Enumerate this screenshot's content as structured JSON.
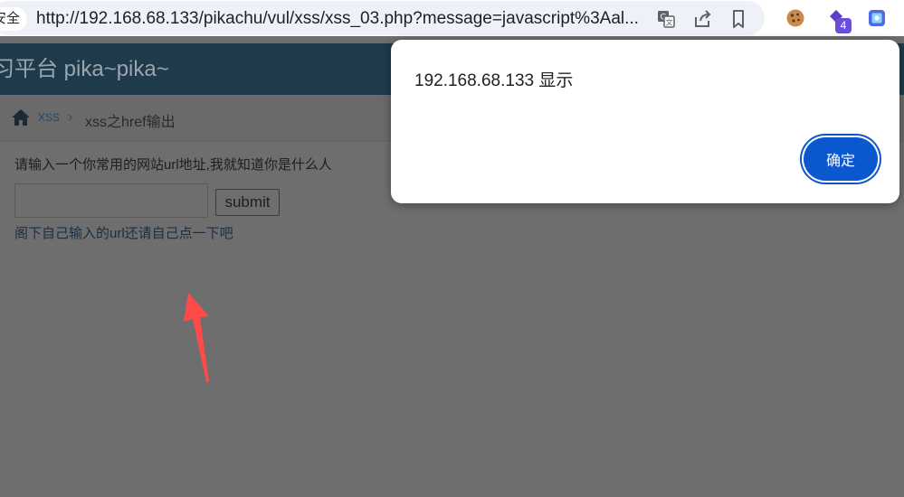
{
  "browser": {
    "security_chip": "安全",
    "url": "http://192.168.68.133/pikachu/vul/xss/xss_03.php?message=javascript%3Aal...",
    "extension_badge": "4",
    "icons": [
      "translate-icon",
      "share-icon",
      "bookmark-icon",
      "cookie-extension-icon",
      "extension-icon",
      "screenshot-extension-icon"
    ]
  },
  "header": {
    "title": "习平台 pika~pika~"
  },
  "breadcrumb": {
    "link": "xss",
    "separator": "›",
    "current": "xss之href输出"
  },
  "main": {
    "prompt": "请输入一个你常用的网站url地址,我就知道你是什么人",
    "input_value": "",
    "submit_label": "submit",
    "result_link": "阁下自己输入的url还请自己点一下吧"
  },
  "dialog": {
    "title": "192.168.68.133 显示",
    "ok_label": "确定"
  },
  "colors": {
    "overlay_background": "#6e6e6e",
    "header": "#1f3a4b",
    "dialog_button": "#0b57d0",
    "annotation_arrow": "#ff4a4a"
  }
}
